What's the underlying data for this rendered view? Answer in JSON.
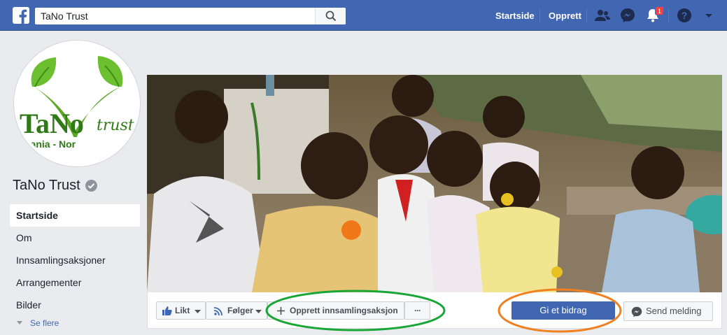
{
  "topbar": {
    "search_value": "TaNo Trust",
    "nav_home": "Startside",
    "nav_create": "Opprett",
    "notification_count": "1",
    "bg_color": "#4267b2"
  },
  "page": {
    "name": "TaNo Trust",
    "logo_text_main": "TaNo",
    "logo_text_script": "trust",
    "logo_subtext": "nzania - Nor"
  },
  "sidebar": {
    "items": [
      {
        "label": "Startside"
      },
      {
        "label": "Om"
      },
      {
        "label": "Innsamlingsaksjoner"
      },
      {
        "label": "Arrangementer"
      },
      {
        "label": "Bilder"
      }
    ],
    "see_more": "Se flere"
  },
  "actions": {
    "like": "Likt",
    "follow": "Følger",
    "create_fundraiser": "Opprett innsamlingsaksjon",
    "more": "···",
    "donate": "Gi et bidrag",
    "send_message": "Send melding"
  },
  "colors": {
    "annotation_green": "#1aa637",
    "annotation_orange": "#f08020",
    "primary": "#4267b2"
  }
}
